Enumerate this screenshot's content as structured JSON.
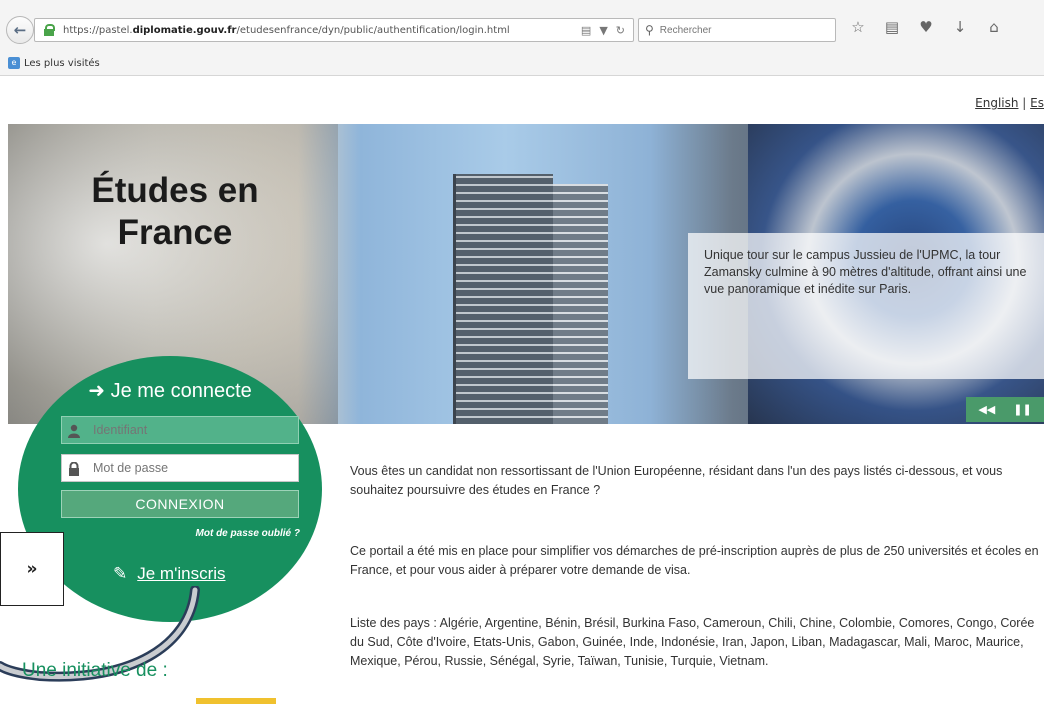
{
  "browser": {
    "url_prefix": "https://pastel.",
    "url_domain": "diplomatie.gouv.fr",
    "url_path": "/etudesenfrance/dyn/public/authentification/login.html",
    "search_placeholder": "Rechercher",
    "bookmarks_label": "Les plus visités"
  },
  "lang": {
    "english": "English",
    "separator": " | ",
    "next": "Es"
  },
  "hero": {
    "title": "Études en France",
    "caption": "Unique tour sur le campus Jussieu de l'UPMC, la tour Zamansky culmine à 90 mètres d'altitude, offrant ainsi une vue panoramique et inédite sur Paris."
  },
  "login": {
    "title": "Je me connecte",
    "username_placeholder": "Identifiant",
    "password_placeholder": "Mot de passe",
    "submit": "CONNEXION",
    "forgot": "Mot de passe oublié ?",
    "signup": "Je m'inscris"
  },
  "callout": {
    "symbol": "»"
  },
  "initiative": "Une initiative de :",
  "content": {
    "intro": "Vous êtes un candidat non ressortissant de l'Union Européenne, résidant dans l'un des pays listés ci-dessous, et vous souhaitez poursuivre des études en France ?",
    "portal": "Ce portail a été mis en place pour simplifier vos démarches de pré-inscription auprès de plus de 250 universités et écoles en France, et pour vous aider à préparer votre demande de visa.",
    "countries": "Liste des pays : Algérie, Argentine, Bénin, Brésil, Burkina Faso, Cameroun, Chili, Chine, Colombie, Comores, Congo, Corée du Sud, Côte d'Ivoire, Etats-Unis, Gabon, Guinée, Inde, Indonésie, Iran, Japon, Liban, Madagascar, Mali, Maroc, Maurice, Mexique, Pérou, Russie, Sénégal, Syrie, Taïwan, Tunisie, Turquie, Vietnam."
  },
  "colors": {
    "accent": "#17905f",
    "field_active": "#52b28a",
    "button": "#55a87c"
  }
}
